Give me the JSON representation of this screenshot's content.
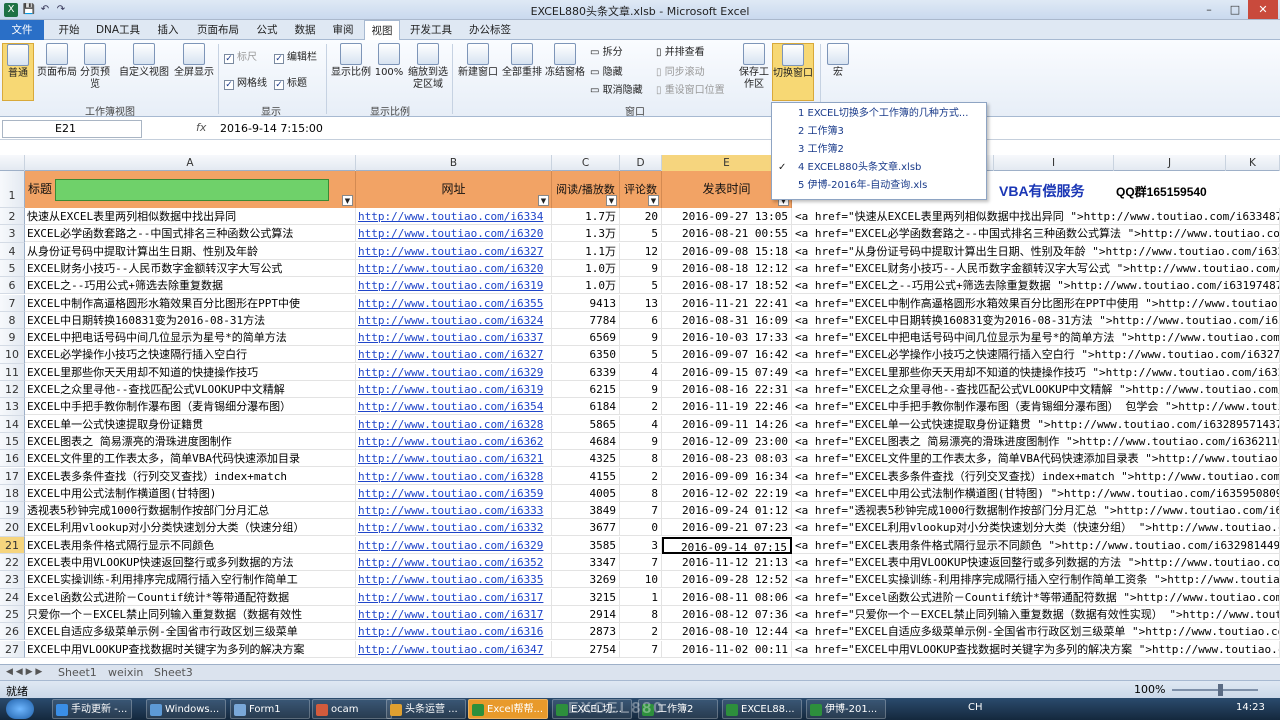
{
  "window": {
    "title": "EXCEL880头条文章.xlsb - Microsoft Excel",
    "min": "–",
    "max": "□",
    "close": "✕"
  },
  "qat": {
    "save": "💾",
    "undo": "↶",
    "redo": "↷"
  },
  "tabs": [
    "文件",
    "开始",
    "DNA工具",
    "插入",
    "页面布局",
    "公式",
    "数据",
    "审阅",
    "视图",
    "开发工具",
    "办公标签"
  ],
  "active_tab": "视图",
  "ribbon": {
    "groups": {
      "workbook_views": "工作簿视图",
      "show": "显示",
      "zoom": "显示比例",
      "window": "窗口"
    },
    "buttons": {
      "normal": "普通",
      "page_layout": "页面布局",
      "page_break": "分页预览",
      "custom_view": "自定义视图",
      "fullscreen": "全屏显示",
      "zoom": "显示比例",
      "zoom100": "100%",
      "zoom_sel": "缩放到选定区域",
      "new_window": "新建窗口",
      "arrange_all": "全部重排",
      "freeze": "冻结窗格",
      "save_ws": "保存工作区",
      "switch_window": "切换窗口",
      "macro": "宏"
    },
    "checks": {
      "ruler": "标尺",
      "formula_bar": "编辑栏",
      "gridlines": "网格线",
      "headings": "标题"
    },
    "win_items": {
      "split": "拆分",
      "hide": "隐藏",
      "unhide": "取消隐藏",
      "side_by_side": "并排查看",
      "sync_scroll": "同步滚动",
      "reset_pos": "重设窗口位置"
    }
  },
  "formula": {
    "namebox": "E21",
    "fx": "fx",
    "value": "2016-9-14  7:15:00"
  },
  "columns": [
    "A",
    "B",
    "C",
    "D",
    "E",
    "F",
    "G",
    "H",
    "I",
    "J",
    "K"
  ],
  "headers": {
    "title": "标题",
    "url": "网址",
    "reads": "阅读/播放数",
    "comments": "评论数",
    "time": "发表时间"
  },
  "extra": {
    "vba": "VBA有偿服务",
    "qq": "QQ群165159540"
  },
  "rows": [
    {
      "n": "2",
      "a": "快速从EXCEL表里两列相似数据中找出异同",
      "b": "http://www.toutiao.com/i6334",
      "c": "1.7万",
      "d": "20",
      "e": "2016-09-27 13:05",
      "f": "<a href=\"快速从EXCEL表里两列相似数据中找出异同 \">http://www.toutiao.com/i633487377"
    },
    {
      "n": "3",
      "a": "EXCEL必学函数套路之--中国式排名三种函数公式算法",
      "b": "http://www.toutiao.com/i6320",
      "c": "1.3万",
      "d": "5",
      "e": "2016-08-21 00:55",
      "f": "<a href=\"EXCEL必学函数套路之--中国式排名三种函数公式算法 \">http://www.toutiao.com/i"
    },
    {
      "n": "4",
      "a": "从身份证号码中提取计算出生日期、性别及年龄",
      "b": "http://www.toutiao.com/i6327",
      "c": "1.1万",
      "d": "12",
      "e": "2016-09-08 15:18",
      "f": "<a href=\"从身份证号码中提取计算出生日期、性别及年龄 \">http://www.toutiao.com/i63278"
    },
    {
      "n": "5",
      "a": "EXCEL财务小技巧--人民币数字金额转汉字大写公式",
      "b": "http://www.toutiao.com/i6320",
      "c": "1.0万",
      "d": "9",
      "e": "2016-08-18 12:12",
      "f": "<a href=\"EXCEL财务小技巧--人民币数字金额转汉字大写公式 \">http://www.toutiao.com/i6"
    },
    {
      "n": "6",
      "a": "EXCEL之--巧用公式+筛选去除重复数据",
      "b": "http://www.toutiao.com/i6319",
      "c": "1.0万",
      "d": "5",
      "e": "2016-08-17 18:52",
      "f": "<a href=\"EXCEL之--巧用公式+筛选去除重复数据 \">http://www.toutiao.com/i6319748762872"
    },
    {
      "n": "7",
      "a": "EXCEL中制作高逼格圆形水箱效果百分比图形在PPT中使",
      "b": "http://www.toutiao.com/i6355",
      "c": "9413",
      "d": "13",
      "e": "2016-11-21 22:41",
      "f": "<a href=\"EXCEL中制作高逼格圆形水箱效果百分比图形在PPT中使用 \">http://www.toutiao.com"
    },
    {
      "n": "8",
      "a": "EXCEL中日期转换160831变为2016-08-31方法",
      "b": "http://www.toutiao.com/i6324",
      "c": "7784",
      "d": "6",
      "e": "2016-08-31 16:09",
      "f": "<a href=\"EXCEL中日期转换160831变为2016-08-31方法 \">http://www.toutiao.com/i632490195"
    },
    {
      "n": "9",
      "a": "EXCEL中把电话号码中间几位显示为星号*的简单方法",
      "b": "http://www.toutiao.com/i6337",
      "c": "6569",
      "d": "9",
      "e": "2016-10-03 17:33",
      "f": "<a href=\"EXCEL中把电话号码中间几位显示为星号*的简单方法 \">http://www.toutiao.com/i"
    },
    {
      "n": "10",
      "a": "EXCEL必学操作小技巧之快速隔行插入空白行",
      "b": "http://www.toutiao.com/i6327",
      "c": "6350",
      "d": "5",
      "e": "2016-09-07 16:42",
      "f": "<a href=\"EXCEL必学操作小技巧之快速隔行插入空白行 \">http://www.toutiao.com/i63275079"
    },
    {
      "n": "11",
      "a": "EXCEL里那些你天天用却不知道的快捷操作技巧",
      "b": "http://www.toutiao.com/i6329",
      "c": "6339",
      "d": "4",
      "e": "2016-09-15 07:49",
      "f": "<a href=\"EXCEL里那些你天天用却不知道的快捷操作技巧 \">http://www.toutiao.com/i632999"
    },
    {
      "n": "12",
      "a": "EXCEL之众里寻他--查找匹配公式VLOOKUP中文精解",
      "b": "http://www.toutiao.com/i6319",
      "c": "6215",
      "d": "9",
      "e": "2016-08-16 22:31",
      "f": "<a href=\"EXCEL之众里寻他--查找匹配公式VLOOKUP中文精解 \">http://www.toutiao.com/i63"
    },
    {
      "n": "13",
      "a": "EXCEL中手把手教你制作瀑布图（麦肯锡细分瀑布图）",
      "b": "http://www.toutiao.com/i6354",
      "c": "6184",
      "d": "2",
      "e": "2016-11-19 22:46",
      "f": "<a href=\"EXCEL中手把手教你制作瀑布图（麦肯锡细分瀑布图） 包学会 \">http://www.toutia"
    },
    {
      "n": "14",
      "a": "EXCEL单一公式快速提取身份证籍贯",
      "b": "http://www.toutiao.com/i6328",
      "c": "5865",
      "d": "4",
      "e": "2016-09-11 14:26",
      "f": "<a href=\"EXCEL单一公式快速提取身份证籍贯 \">http://www.toutiao.com/i632895714379798"
    },
    {
      "n": "15",
      "a": "EXCEL图表之 简易漂亮的滑珠进度图制作",
      "b": "http://www.toutiao.com/i6362",
      "c": "4684",
      "d": "9",
      "e": "2016-12-09 23:00",
      "f": "<a href=\"EXCEL图表之 简易漂亮的滑珠进度图制作 \">http://www.toutiao.com/i636211633"
    },
    {
      "n": "16",
      "a": "EXCEL文件里的工作表太多，简单VBA代码快速添加目录",
      "b": "http://www.toutiao.com/i6321",
      "c": "4325",
      "d": "8",
      "e": "2016-08-23 08:03",
      "f": "<a href=\"EXCEL文件里的工作表太多，简单VBA代码快速添加目录表 \">http://www.toutiao.com"
    },
    {
      "n": "17",
      "a": "EXCEL表多条件查找（行列交叉查找）index+match",
      "b": "http://www.toutiao.com/i6328",
      "c": "4155",
      "d": "2",
      "e": "2016-09-09 16:34",
      "f": "<a href=\"EXCEL表多条件查找（行列交叉查找）index+match \">http://www.toutiao.com/i6"
    },
    {
      "n": "18",
      "a": "EXCEL中用公式法制作横道图(甘特图)",
      "b": "http://www.toutiao.com/i6359",
      "c": "4005",
      "d": "8",
      "e": "2016-12-02 22:19",
      "f": "<a href=\"EXCEL中用公式法制作横道图(甘特图) \">http://www.toutiao.com/i635950809245"
    },
    {
      "n": "19",
      "a": "透视表5秒钟完成1000行数据制作按部门分月汇总",
      "b": "http://www.toutiao.com/i6333",
      "c": "3849",
      "d": "7",
      "e": "2016-09-24 01:12",
      "f": "<a href=\"透视表5秒钟完成1000行数据制作按部门分月汇总 \">http://www.toutiao.com/i6333"
    },
    {
      "n": "20",
      "a": "EXCEL利用vlookup对小分类快速划分大类（快速分组）",
      "b": "http://www.toutiao.com/i6332",
      "c": "3677",
      "d": "0",
      "e": "2016-09-21 07:23",
      "f": "<a href=\"EXCEL利用vlookup对小分类快速划分大类（快速分组） \">http://www.toutiao.com"
    },
    {
      "n": "21",
      "a": "EXCEL表用条件格式隔行显示不同颜色",
      "b": "http://www.toutiao.com/i6329",
      "c": "3585",
      "d": "3",
      "e": "2016-09-14 07:15",
      "f": "<a href=\"EXCEL表用条件格式隔行显示不同颜色 \">http://www.toutiao.com/i6329814494084"
    },
    {
      "n": "22",
      "a": "EXCEL表中用VLOOKUP快速返回整行或多列数据的方法",
      "b": "http://www.toutiao.com/i6352",
      "c": "3347",
      "d": "7",
      "e": "2016-11-12 21:13",
      "f": "<a href=\"EXCEL表中用VLOOKUP快速返回整行或多列数据的方法 \">http://www.toutiao.com/i6"
    },
    {
      "n": "23",
      "a": "EXCEL实操训练-利用排序完成隔行插入空行制作简单工",
      "b": "http://www.toutiao.com/i6335",
      "c": "3269",
      "d": "10",
      "e": "2016-09-28 12:52",
      "f": "<a href=\"EXCEL实操训练-利用排序完成隔行插入空行制作简单工资条 \">http://www.toutiao.com"
    },
    {
      "n": "24",
      "a": "Excel函数公式进阶－Countif统计*等带通配符数据",
      "b": "http://www.toutiao.com/i6317",
      "c": "3215",
      "d": "1",
      "e": "2016-08-11 08:06",
      "f": "<a href=\"Excel函数公式进阶－Countif统计*等带通配符数据 \">http://www.toutiao.com/i63"
    },
    {
      "n": "25",
      "a": "只爱你一个－EXCEL禁止同列输入重复数据（数据有效性",
      "b": "http://www.toutiao.com/i6317",
      "c": "2914",
      "d": "8",
      "e": "2016-08-12 07:36",
      "f": "<a href=\"只爱你一个－EXCEL禁止同列输入重复数据（数据有效性实现） \">http://www.toutiao.co"
    },
    {
      "n": "26",
      "a": "EXCEL自适应多级菜单示例-全国省市行政区划三级菜单",
      "b": "http://www.toutiao.com/i6316",
      "c": "2873",
      "d": "2",
      "e": "2016-08-10 12:44",
      "f": "<a href=\"EXCEL自适应多级菜单示例-全国省市行政区划三级菜单 \">http://www.toutiao.com/i6"
    },
    {
      "n": "27",
      "a": "EXCEL中用VLOOKUP查找数据时关键字为多列的解决方案",
      "b": "http://www.toutiao.com/i6347",
      "c": "2754",
      "d": "7",
      "e": "2016-11-02 00:11",
      "f": "<a href=\"EXCEL中用VLOOKUP查找数据时关键字为多列的解决方案 \">http://www.toutiao.co"
    }
  ],
  "popup": [
    {
      "label": "1 EXCEL切换多个工作簿的几种方式...",
      "checked": false
    },
    {
      "label": "2 工作簿3",
      "checked": false
    },
    {
      "label": "3 工作簿2",
      "checked": false
    },
    {
      "label": "4 EXCEL880头条文章.xlsb",
      "checked": true
    },
    {
      "label": "5 伊博-2016年-自动查询.xls",
      "checked": false
    }
  ],
  "sheets": [
    "Sheet1",
    "weixin",
    "Sheet3"
  ],
  "status": {
    "ready": "就绪",
    "zoom": "100%"
  },
  "taskbar": [
    {
      "label": "手动更新 -...",
      "color": "#3a8ee6"
    },
    {
      "label": "Windows...",
      "color": "#5d9ad6"
    },
    {
      "label": "Form1",
      "color": "#7aa8d8"
    },
    {
      "label": "ocam",
      "color": "#d35b3c"
    },
    {
      "label": "头条运营 ...",
      "color": "#e0a030"
    },
    {
      "label": "Excel帮帮...",
      "color": "#2d8f3c"
    },
    {
      "label": "EXCEL切...",
      "color": "#2d8f3c"
    },
    {
      "label": "工作簿2",
      "color": "#2d8f3c"
    },
    {
      "label": "EXCEL88...",
      "color": "#2d8f3c"
    },
    {
      "label": "伊博-201...",
      "color": "#2d8f3c"
    }
  ],
  "tray": {
    "lang": "CH",
    "time": "14:23"
  },
  "watermark": "EXCEL880"
}
